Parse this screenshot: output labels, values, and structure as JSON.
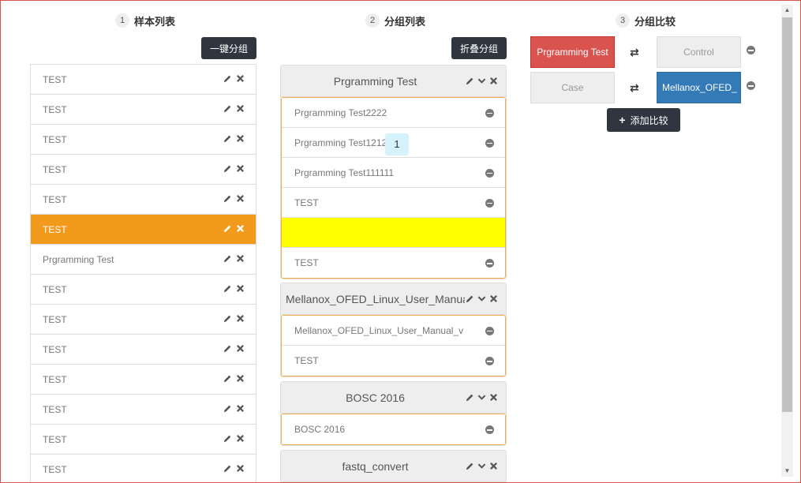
{
  "steps": [
    {
      "num": "1",
      "label": "样本列表"
    },
    {
      "num": "2",
      "label": "分组列表"
    },
    {
      "num": "3",
      "label": "分组比较"
    }
  ],
  "buttons": {
    "auto_group": "一键分组",
    "collapse_group": "折叠分组",
    "add_compare": "添加比较"
  },
  "samples": [
    "TEST",
    "TEST",
    "TEST",
    "TEST",
    "TEST",
    "TEST",
    "Prgramming Test",
    "TEST",
    "TEST",
    "TEST",
    "TEST",
    "TEST",
    "TEST",
    "TEST"
  ],
  "active_sample_index": 5,
  "groups": [
    {
      "title": "Prgramming Test",
      "items": [
        "Prgramming Test2222",
        "Prgramming Test121212",
        "Prgramming Test111111",
        "TEST",
        "",
        "TEST"
      ]
    },
    {
      "title": "Mellanox_OFED_Linux_User_Manual",
      "items": [
        "Mellanox_OFED_Linux_User_Manual_v",
        "TEST"
      ]
    },
    {
      "title": "BOSC 2016",
      "items": [
        "BOSC 2016"
      ]
    },
    {
      "title": "fastq_convert",
      "items": []
    }
  ],
  "drag_badge": "1",
  "comparisons": [
    {
      "left": "Prgramming Test",
      "right": "Control"
    },
    {
      "left": "Case",
      "right": "Mellanox_OFED_"
    }
  ],
  "swap_symbol": "⇄",
  "colors": {
    "accent": "#f29a1c",
    "dark_button": "#2f3640",
    "red": "#d9534f",
    "blue": "#337ab7",
    "drop_placeholder": "#ffff00"
  }
}
